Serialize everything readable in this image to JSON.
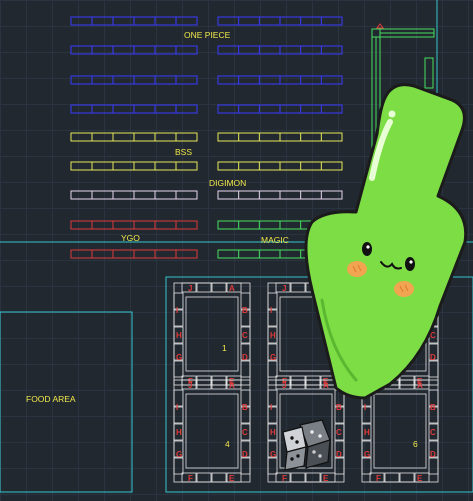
{
  "sections": [
    {
      "key": "one_piece",
      "label": "ONE PIECE",
      "color": "#3b3bff"
    },
    {
      "key": "bss",
      "label": "BSS",
      "color": "#e8e85a"
    },
    {
      "key": "digimon",
      "label": "DIGIMON",
      "color": "#e8d8ee"
    },
    {
      "key": "ygo",
      "label": "YGO",
      "color": "#e03a3a"
    },
    {
      "key": "magic",
      "label": "MAGIC",
      "color": "#48e060"
    }
  ],
  "food_area_label": "FOOD AREA",
  "table_numbers": [
    "1",
    "4",
    "6"
  ],
  "seat_letters": {
    "a": "A",
    "b": "B",
    "c": "C",
    "d": "D",
    "e": "E",
    "f": "F",
    "g": "G",
    "h": "H",
    "i": "I",
    "j": "J"
  },
  "colors": {
    "outline": "#34c6cf",
    "mascot": "#7ddd45",
    "mascot_outline": "#1b1b1b",
    "seat_letter": "#e03a3a"
  },
  "icons": [
    "arrow-mascot-icon",
    "dice-icon"
  ]
}
